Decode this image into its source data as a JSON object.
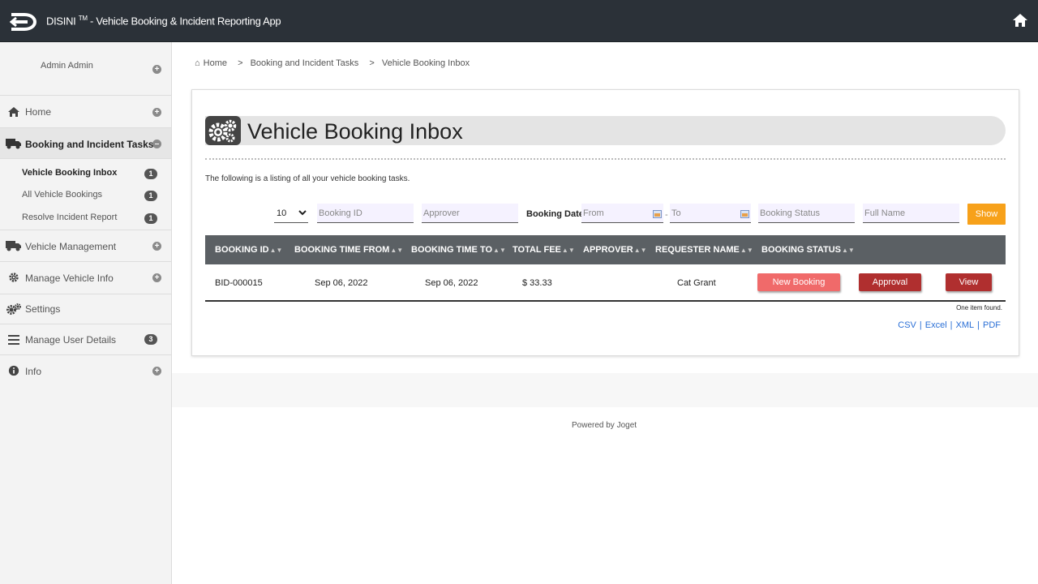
{
  "header": {
    "brand": "DISINI",
    "tm": "TM",
    "title_suffix": " - Vehicle Booking & Incident Reporting App"
  },
  "sidebar": {
    "user_name": "Admin Admin",
    "items": [
      {
        "label": "Home",
        "icon": "home-icon"
      },
      {
        "label": "Booking and Incident Tasks",
        "icon": "truck-icon"
      },
      {
        "label": "Vehicle Management",
        "icon": "truck-icon"
      },
      {
        "label": "Manage Vehicle Info",
        "icon": "gear-icon"
      },
      {
        "label": "Settings",
        "icon": "gears-icon"
      },
      {
        "label": "Manage User Details",
        "icon": "menu-icon",
        "badge": "3"
      },
      {
        "label": "Info",
        "icon": "info-icon"
      }
    ],
    "sub_items": [
      {
        "label": "Vehicle Booking Inbox",
        "badge": "1"
      },
      {
        "label": "All Vehicle Bookings",
        "badge": "1"
      },
      {
        "label": "Resolve Incident Report",
        "badge": "1"
      }
    ]
  },
  "breadcrumb": {
    "home": "Home",
    "sep": ">",
    "level1": "Booking and Incident Tasks",
    "level2": "Vehicle Booking Inbox"
  },
  "page": {
    "title": "Vehicle Booking Inbox",
    "description": "The following is a listing of all your vehicle booking tasks."
  },
  "filters": {
    "page_size": "10",
    "booking_id_placeholder": "Booking ID",
    "approver_placeholder": "Approver",
    "booking_date_label": "Booking Date",
    "from_placeholder": "From",
    "dash": "-",
    "to_placeholder": "To",
    "status_placeholder": "Booking Status",
    "fullname_placeholder": "Full Name",
    "show_label": "Show"
  },
  "table": {
    "columns": [
      "BOOKING ID",
      "BOOKING TIME FROM",
      "BOOKING TIME TO",
      "TOTAL FEE",
      "APPROVER",
      "REQUESTER NAME",
      "BOOKING STATUS"
    ],
    "rows": [
      {
        "booking_id": "BID-000015",
        "time_from": "Sep 06, 2022",
        "time_to": "Sep 06, 2022",
        "total_fee": "$ 33.33",
        "approver": "",
        "requester": "Cat Grant",
        "status": "New Booking",
        "action_approval": "Approval",
        "action_view": "View"
      }
    ],
    "found": "One item found.",
    "exports": [
      "CSV",
      "Excel",
      "XML",
      "PDF"
    ]
  },
  "footer": {
    "powered": "Powered by Joget"
  },
  "colors": {
    "topbar": "#2b3138",
    "show_button": "#f7a11a",
    "table_header": "#5b6064",
    "status_badge": "#f06a6a",
    "action_button": "#b02f2f",
    "link": "#2a6fd6"
  }
}
